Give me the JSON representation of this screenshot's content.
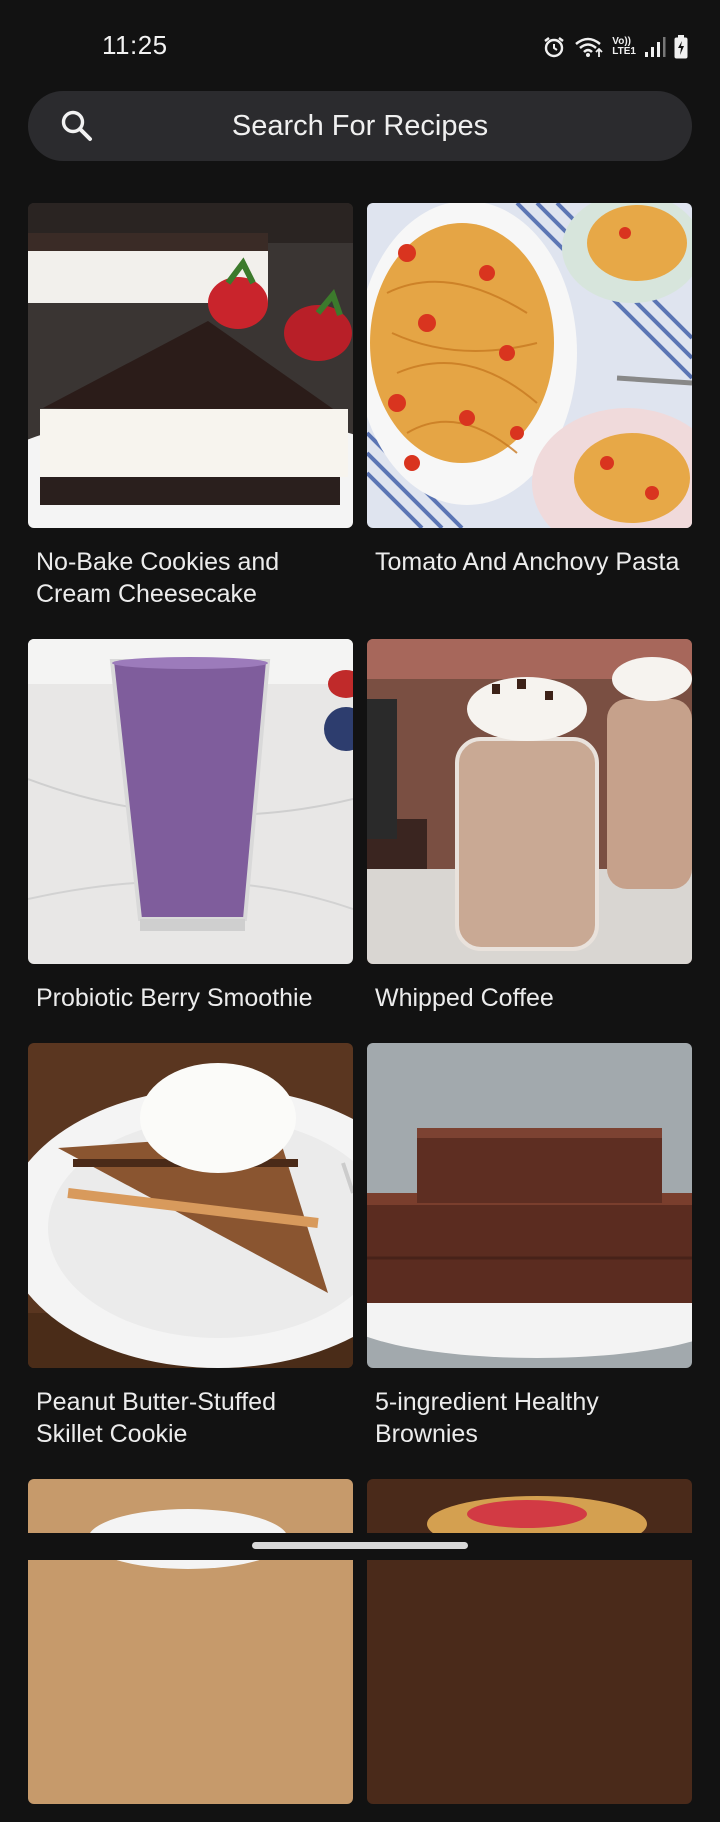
{
  "status_bar": {
    "time": "11:25",
    "icons": [
      "alarm-icon",
      "wifi-icon",
      "volte-icon",
      "signal-icon",
      "battery-charging-icon"
    ],
    "volte_label_top": "Vo))",
    "volte_label_bottom": "LTE1"
  },
  "search": {
    "placeholder": "Search For Recipes",
    "icon": "search-icon"
  },
  "recipes": [
    {
      "title": "No-Bake Cookies and Cream Cheesecake"
    },
    {
      "title": "Tomato And Anchovy Pasta"
    },
    {
      "title": "Probiotic Berry Smoothie"
    },
    {
      "title": "Whipped Coffee"
    },
    {
      "title": "Peanut Butter-Stuffed Skillet Cookie"
    },
    {
      "title": "5-ingredient Healthy Brownies"
    },
    {
      "title": ""
    },
    {
      "title": ""
    }
  ],
  "colors": {
    "background": "#121212",
    "search_bar": "#2b2b2e",
    "text": "#ececec"
  }
}
